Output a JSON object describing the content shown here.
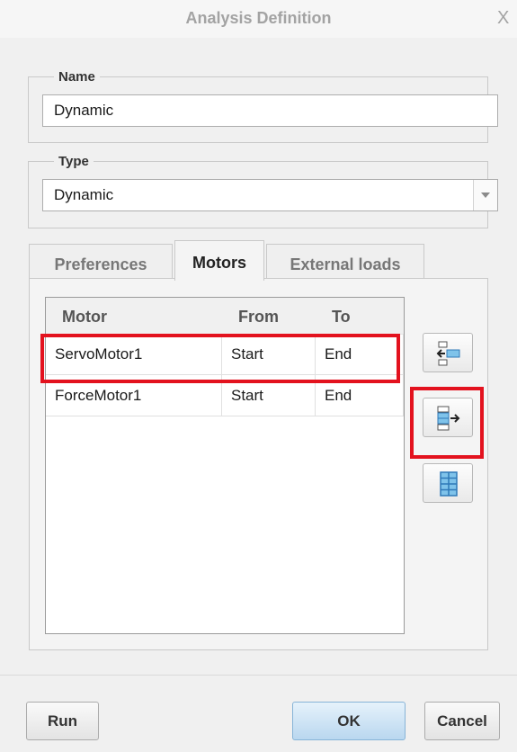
{
  "window": {
    "title": "Analysis Definition",
    "close_glyph": "X"
  },
  "name_group": {
    "legend": "Name",
    "value": "Dynamic"
  },
  "type_group": {
    "legend": "Type",
    "selected": "Dynamic"
  },
  "tabs": [
    {
      "label": "Preferences",
      "active": false
    },
    {
      "label": "Motors",
      "active": true
    },
    {
      "label": "External loads",
      "active": false
    }
  ],
  "motors_table": {
    "headers": {
      "motor": "Motor",
      "from": "From",
      "to": "To"
    },
    "rows": [
      {
        "motor": "ServoMotor1",
        "from": "Start",
        "to": "End",
        "highlighted": true
      },
      {
        "motor": "ForceMotor1",
        "from": "Start",
        "to": "End",
        "highlighted": false
      }
    ]
  },
  "side_tools": [
    {
      "icon": "add-motor-icon"
    },
    {
      "icon": "remove-motor-icon",
      "highlighted": true
    },
    {
      "icon": "select-all-motors-icon"
    }
  ],
  "footer": {
    "run_label": "Run",
    "ok_label": "OK",
    "cancel_label": "Cancel"
  },
  "colors": {
    "highlight": "#e3121e",
    "icon_blue": "#3d86c6",
    "ok_button": "#b9d7ef"
  }
}
